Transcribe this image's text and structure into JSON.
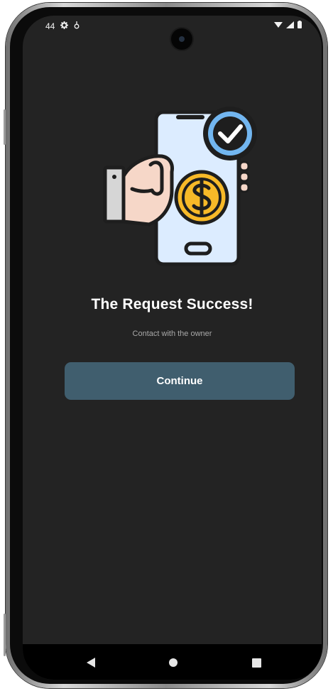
{
  "status_bar": {
    "left_text": "44",
    "icons": [
      "gear-icon",
      "antenna-icon"
    ],
    "right_icons": [
      "wifi-icon",
      "signal-icon",
      "battery-icon"
    ]
  },
  "illustration": {
    "icons": [
      "phone-icon",
      "hand-icon",
      "dollar-coin-icon",
      "check-badge-icon"
    ],
    "colors": {
      "phone": "#dcecff",
      "check_badge": "#72b6f0",
      "coin": "#f7b928",
      "skin": "#f6d7c8",
      "outline": "#1e1e1e"
    }
  },
  "main": {
    "title": "The Request Success!",
    "subtitle": "Contact with the owner",
    "continue_label": "Continue"
  },
  "nav_bar": {
    "buttons": [
      "back-icon",
      "home-icon",
      "recents-icon"
    ]
  },
  "colors": {
    "screen_background": "#232323",
    "button_background": "#405e6e",
    "title_text": "#ffffff",
    "subtitle_text": "#a9a9a9"
  }
}
